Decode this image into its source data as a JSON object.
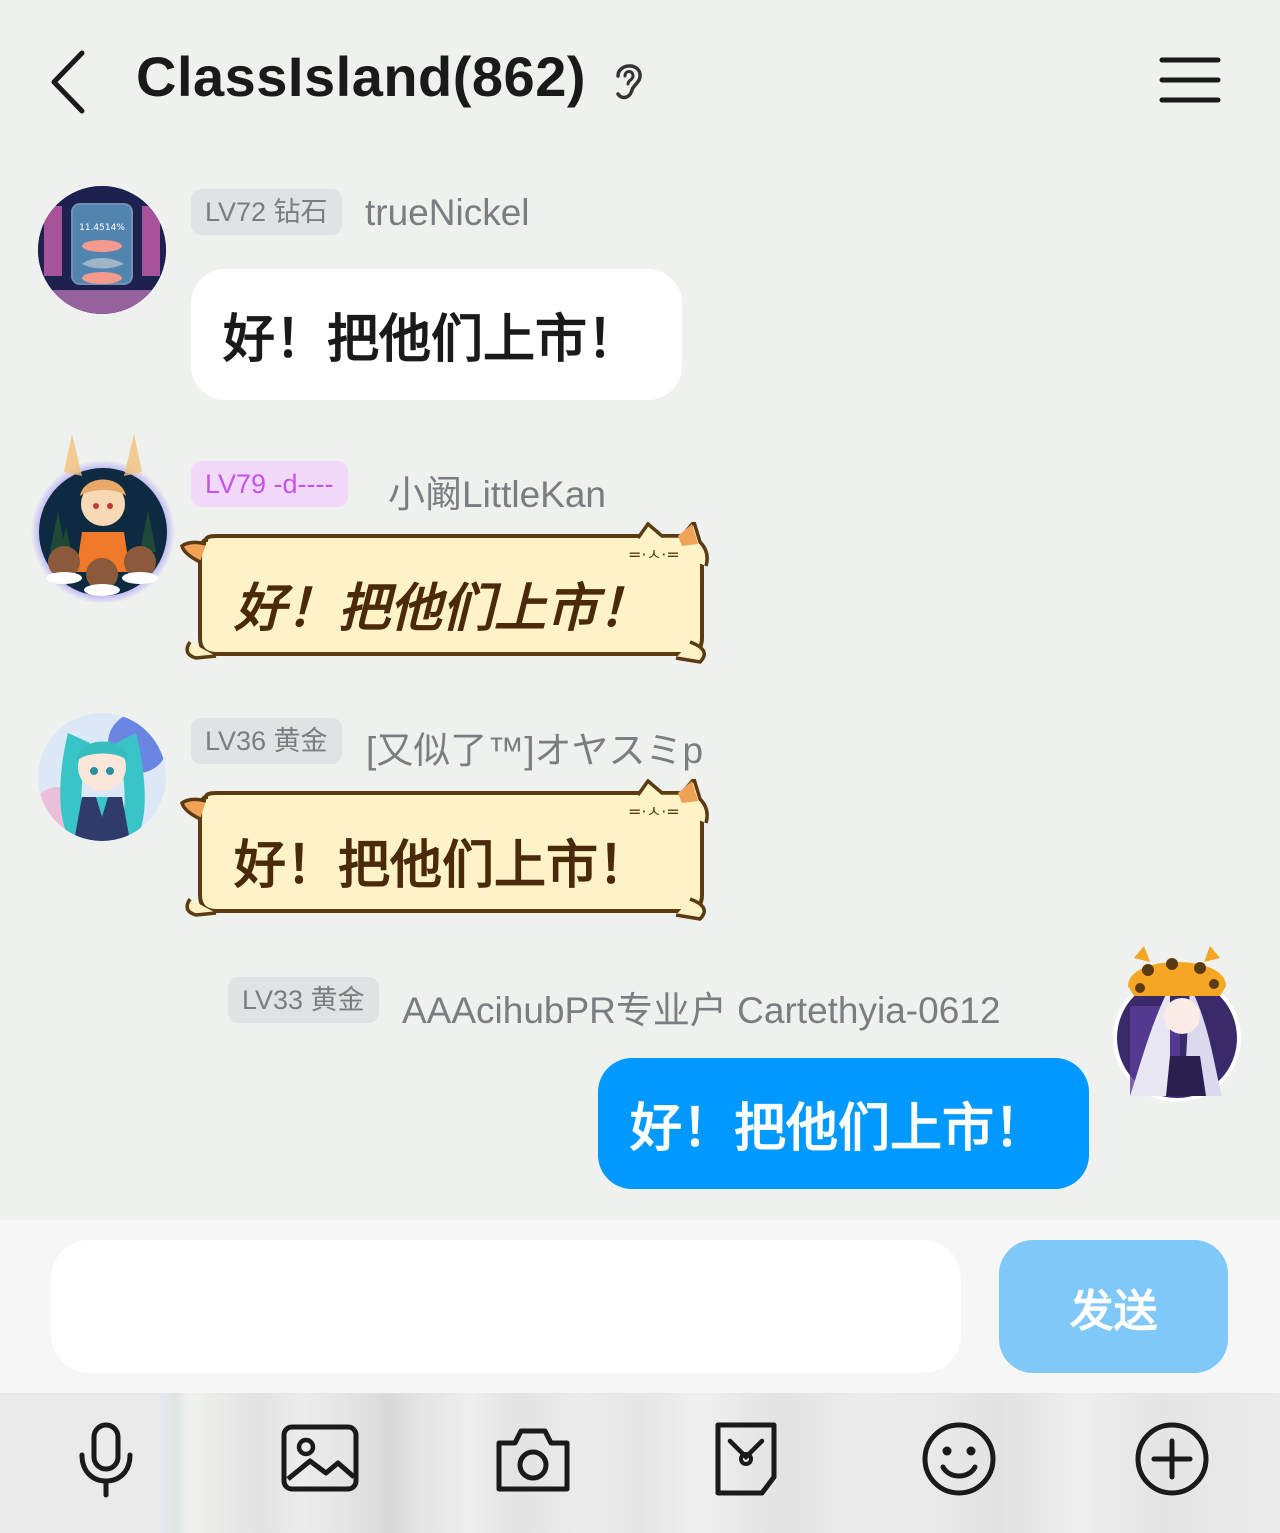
{
  "header": {
    "title": "ClassIsland(862)"
  },
  "messages": [
    {
      "level": "LV72 钻石",
      "nickname": "trueNickel",
      "text": "好！把他们上市！",
      "bubble_style": "white",
      "avatar_caption": "11.4514%"
    },
    {
      "level": "LV79 -d----",
      "nickname": "小阚LittleKan",
      "text": "好！把他们上市！",
      "bubble_style": "cat"
    },
    {
      "level": "LV36 黄金",
      "nickname": "[又似了™]オヤスミp",
      "text": "好！把他们上市！",
      "bubble_style": "cat"
    },
    {
      "level": "LV33 黄金",
      "nickname": "AAAcihubPR专业户 Cartethyia-0612",
      "text": "好！把他们上市！",
      "bubble_style": "self-blue"
    }
  ],
  "composer": {
    "input_value": "",
    "send_label": "发送"
  },
  "toolbar": {
    "icons": [
      "microphone-icon",
      "image-icon",
      "camera-icon",
      "sticker-icon",
      "emoji-icon",
      "plus-icon"
    ]
  },
  "colors": {
    "background": "#eef1ee",
    "self_bubble": "#0099ff",
    "send_button": "#80c8f8",
    "level_badge_purple": "#c356ea",
    "cat_bubble_fill": "#fdf3c6",
    "cat_bubble_stroke": "#5c3a12"
  }
}
